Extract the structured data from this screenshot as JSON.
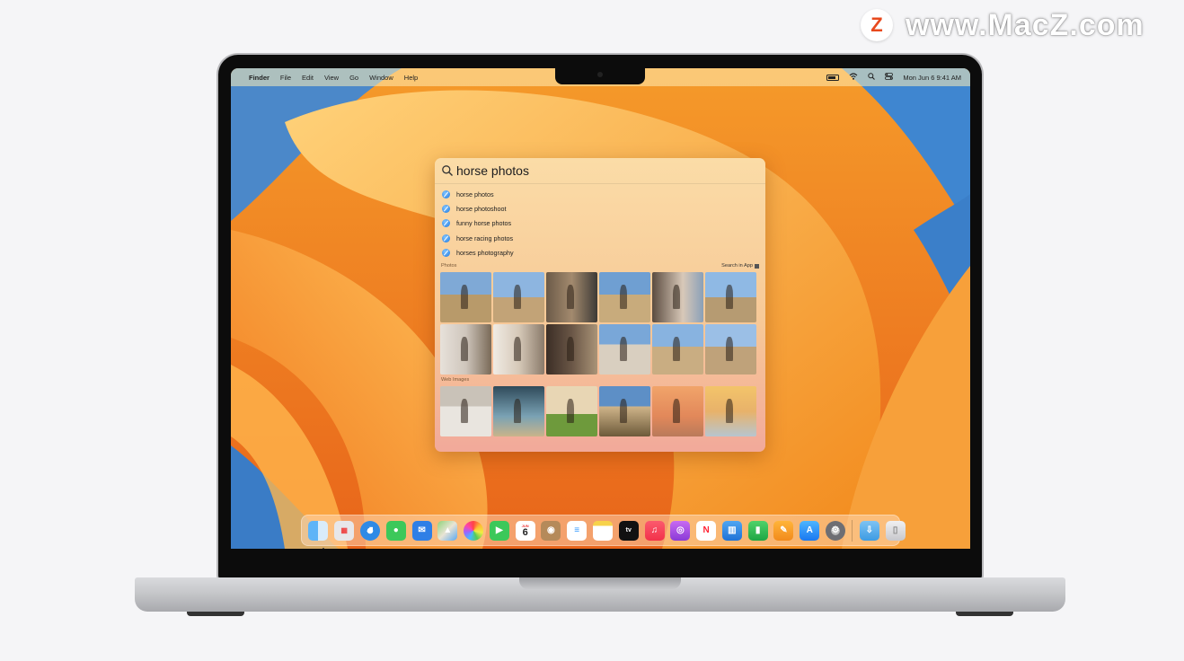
{
  "watermark": {
    "badge": "Z",
    "text": "www.MacZ.com"
  },
  "menubar": {
    "apple": "",
    "app_name": "Finder",
    "items": [
      "File",
      "Edit",
      "View",
      "Go",
      "Window",
      "Help"
    ],
    "datetime": "Mon Jun 6  9:41 AM"
  },
  "spotlight": {
    "query": "horse photos",
    "suggestions": [
      "horse photos",
      "horse photoshoot",
      "funny horse photos",
      "horse racing photos",
      "horses photography"
    ],
    "photos_header": "Photos",
    "search_in_app": "Search in App",
    "web_images_header": "Web Images"
  },
  "dock": {
    "items": [
      "finder-icon",
      "launchpad-icon",
      "safari-icon",
      "messages-icon",
      "mail-icon",
      "maps-icon",
      "photos-icon",
      "facetime-icon",
      "calendar-icon",
      "contacts-icon",
      "reminders-icon",
      "notes-icon",
      "tv-icon",
      "music-icon",
      "podcasts-icon",
      "news-icon",
      "keynote-icon",
      "numbers-icon",
      "pages-icon",
      "app-store-icon",
      "system-settings-icon",
      "downloads-icon",
      "trash-icon"
    ],
    "calendar_month": "JUN",
    "calendar_day": "6",
    "tv_label": "tv"
  }
}
